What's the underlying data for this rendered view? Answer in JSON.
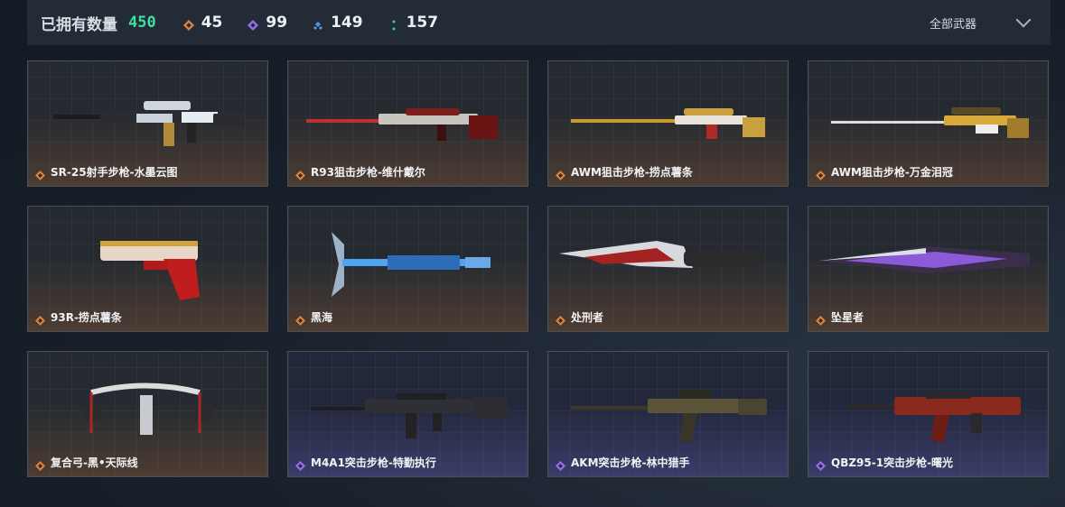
{
  "header": {
    "owned_label": "已拥有数量",
    "owned_count": "450",
    "stats": [
      {
        "icon": "orange-rarity-icon",
        "color": "#e0813a",
        "value": "45"
      },
      {
        "icon": "purple-rarity-icon",
        "color": "#9a6cf0",
        "value": "99"
      },
      {
        "icon": "blue-rarity-icon",
        "color": "#4a9be8",
        "value": "149"
      },
      {
        "icon": "green-rarity-icon",
        "color": "#2fc79a",
        "value": "157"
      }
    ],
    "filter_label": "全部武器"
  },
  "colors": {
    "orange": "#e0813a",
    "purple": "#9a6cf0",
    "owned": "#3fe0a0"
  },
  "weapons": [
    {
      "name": "SR-25射手步枪-水墨云图",
      "rarity": "orange",
      "art": "rifle-1"
    },
    {
      "name": "R93狙击步枪-维什戴尔",
      "rarity": "orange",
      "art": "sniper-red"
    },
    {
      "name": "AWM狙击步枪-捞点薯条",
      "rarity": "orange",
      "art": "sniper-gold"
    },
    {
      "name": "AWM狙击步枪-万金泪冠",
      "rarity": "orange",
      "art": "sniper-gold2"
    },
    {
      "name": "93R-捞点薯条",
      "rarity": "orange",
      "art": "pistol"
    },
    {
      "name": "黑海",
      "rarity": "orange",
      "art": "axe"
    },
    {
      "name": "处刑者",
      "rarity": "orange",
      "art": "knife"
    },
    {
      "name": "坠星者",
      "rarity": "orange",
      "art": "blade"
    },
    {
      "name": "复合弓-黑•天际线",
      "rarity": "orange",
      "art": "bow"
    },
    {
      "name": "M4A1突击步枪-特勤执行",
      "rarity": "purple",
      "art": "m4"
    },
    {
      "name": "AKM突击步枪-林中猎手",
      "rarity": "purple",
      "art": "ak"
    },
    {
      "name": "QBZ95-1突击步枪-曙光",
      "rarity": "purple",
      "art": "qbz"
    }
  ]
}
